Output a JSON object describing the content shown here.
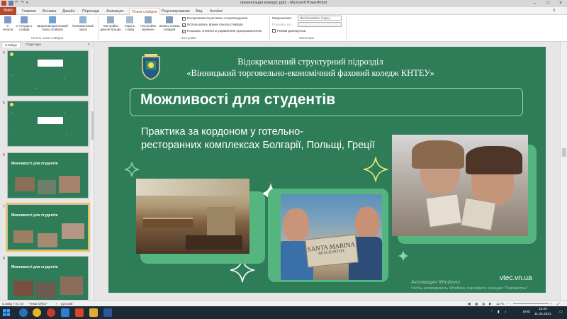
{
  "window": {
    "title": "презентация конкурс.pptx  -  Microsoft PowerPoint"
  },
  "tabs": [
    "Файл",
    "Главная",
    "Вставка",
    "Дизайн",
    "Переходы",
    "Анимация",
    "Показ слайдов",
    "Рецензирование",
    "Вид",
    "Acrobat"
  ],
  "active_tab": "Показ слайдов",
  "ribbon": {
    "btn_from_start": "С начала",
    "btn_from_current": "С текущего слайда",
    "btn_broadcast": "Широковещательный показ слайдов",
    "btn_custom": "Произвольный показ",
    "group_start": "Начать показ слайдов",
    "btn_setup": "Настройка демонстрации",
    "btn_hide": "Скрыть слайд",
    "btn_timings": "Настройка времени",
    "btn_record": "Запись показа слайдов",
    "chk_narration": "Воспроизвести речевое сопровождение",
    "chk_timings": "Использовать время показа слайдов",
    "chk_controls": "Показать элементы управления проигрывателем",
    "group_setup": "Настройка",
    "resolution_label": "Разрешение:",
    "resolution_value": "Использовать текущ...",
    "show_on_label": "Показать на:",
    "presenter_view": "Режим докладчика",
    "group_monitors": "Мониторы"
  },
  "pane": {
    "tab_slides": "Слайды",
    "tab_outline": "Структура",
    "thumbs": [
      {
        "num": "4"
      },
      {
        "num": "5"
      },
      {
        "num": "6",
        "title": "Можливості для студентів"
      },
      {
        "num": "7",
        "title": "Можливості для студентів"
      },
      {
        "num": "8",
        "title": "Можливості для студентів"
      }
    ]
  },
  "slide": {
    "org_line1": "Відокремлений структурний підрозділ",
    "org_line2": "«Вінницький торговельно-економічний фаховий коледж КНТЕУ»",
    "title": "Можливості для студентів",
    "subtitle_line1": "Практика за кордоном у готельно-",
    "subtitle_line2": "ресторанних комплексах Болгарії, Польщі, Греції",
    "website": "vtec.vn.ua",
    "photo_sign1": "SANTA MARINA",
    "photo_sign2": "BEACH HOTEL"
  },
  "watermark": {
    "line1": "Активация Windows",
    "line2": "Чтобы активировать Windows, перейдите в раздел \"Параметры\"."
  },
  "status": {
    "slide_pos": "Слайд 7 из 15",
    "theme": "\"Тема Office\"",
    "language": "русский",
    "zoom": "117%"
  },
  "taskbar": {
    "lang": "ENG",
    "time": "15:20",
    "date": "11.05.2021"
  },
  "colors": {
    "slide_bg": "#2e7d58",
    "accent_file": "#b7472a",
    "selected_thumb": "#f0c44c"
  }
}
